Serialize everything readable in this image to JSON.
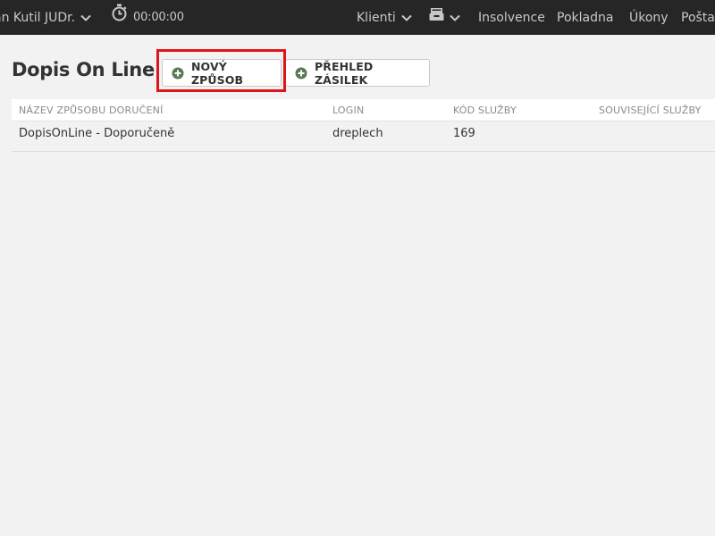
{
  "navbar": {
    "user_name": "an Kutil JUDr.",
    "timer": "00:00:00",
    "clients_label": "Klienti",
    "insolvence_label": "Insolvence",
    "pokladna_label": "Pokladna",
    "ukony_label": "Úkony",
    "posta_label": "Pošta"
  },
  "page": {
    "title": "Dopis On Line"
  },
  "toolbar": {
    "new_method_label": "NOVÝ ZPŮSOB",
    "shipments_overview_label": "PŘEHLED ZÁSILEK"
  },
  "table": {
    "headers": [
      "NÁZEV ZPŮSOBU DORUČENÍ",
      "LOGIN",
      "KÓD SLUŽBY",
      "SOUVISEJÍCÍ SLUŽBY"
    ],
    "rows": [
      {
        "name": "DopisOnLine - Doporučeně",
        "login": "dreplech",
        "code": "169",
        "related": ""
      }
    ]
  },
  "colors": {
    "navbar_bg": "#262626",
    "highlight": "#e0141a",
    "plus_icon": "#5a7a54"
  }
}
